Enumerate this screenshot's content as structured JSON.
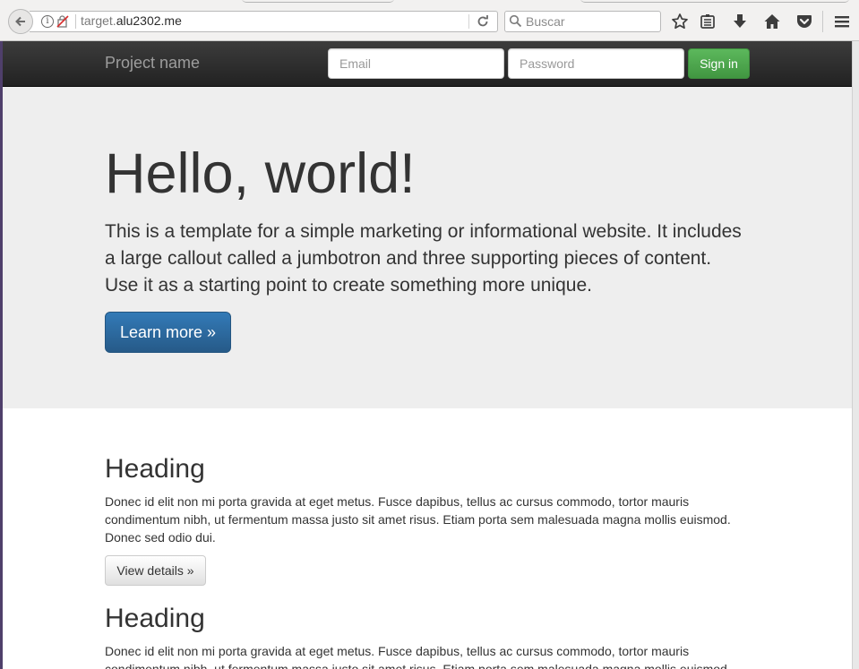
{
  "browser": {
    "url_prefix": "target.",
    "url_domain": "alu2302.me",
    "search_placeholder": "Buscar",
    "icons": [
      "back-icon",
      "info-icon",
      "insecure-icon",
      "reload-icon",
      "search-icon",
      "bookmark-star-icon",
      "reading-list-icon",
      "download-icon",
      "home-icon",
      "pocket-icon",
      "menu-icon"
    ]
  },
  "navbar": {
    "brand": "Project name",
    "email_placeholder": "Email",
    "password_placeholder": "Password",
    "signin_label": "Sign in"
  },
  "jumbotron": {
    "title": "Hello, world!",
    "lead": "This is a template for a simple marketing or informational website. It includes a large callout called a jumbotron and three supporting pieces of content. Use it as a starting point to create something more unique.",
    "button_label": "Learn more »"
  },
  "sections": [
    {
      "heading": "Heading",
      "text": "Donec id elit non mi porta gravida at eget metus. Fusce dapibus, tellus ac cursus commodo, tortor mauris condimentum nibh, ut fermentum massa justo sit amet risus. Etiam porta sem malesuada magna mollis euismod. Donec sed odio dui.",
      "button_label": "View details »"
    },
    {
      "heading": "Heading",
      "text": "Donec id elit non mi porta gravida at eget metus. Fusce dapibus, tellus ac cursus commodo, tortor mauris condimentum nibh, ut fermentum massa justo sit amet risus. Etiam porta sem malesuada magna mollis euismod."
    }
  ],
  "colors": {
    "navbar": "#222222",
    "jumbotron": "#eeeeee",
    "primary": "#337ab7",
    "success": "#5cb85c"
  }
}
